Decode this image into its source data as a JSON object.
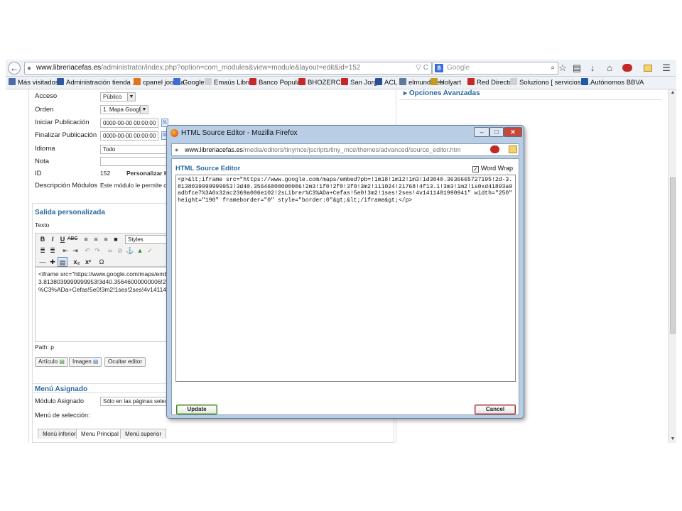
{
  "browser": {
    "url_host": "www.libreriacefas.es",
    "url_path": "/administrator/index.php?option=com_modules&view=module&layout=edit&id=152",
    "search_placeholder": "Google",
    "bookmarks": [
      {
        "label": "Más visitados",
        "color": "#4b6ea8"
      },
      {
        "label": "Administración tienda ...",
        "color": "#2c5aa0"
      },
      {
        "label": "cpanel joomla",
        "color": "#e2731b"
      },
      {
        "label": "Google",
        "color": "#3b6fd8"
      },
      {
        "label": "Emaús Libros",
        "color": "#d0d0d0"
      },
      {
        "label": "Banco Popular",
        "color": "#c62828"
      },
      {
        "label": "BHOZERCK",
        "color": "#c62828"
      },
      {
        "label": "San Jorge",
        "color": "#c62828"
      },
      {
        "label": "ACL",
        "color": "#2b4c9a"
      },
      {
        "label": "elmundo.es",
        "color": "#5f7a98"
      },
      {
        "label": "Holyart",
        "color": "#c59b1b"
      },
      {
        "label": "Red Directo",
        "color": "#c62828"
      },
      {
        "label": "Soluziono [ servicios e...",
        "color": "#d0d0d0"
      },
      {
        "label": "Autónomos BBVA",
        "color": "#1e5aa8"
      }
    ]
  },
  "form": {
    "acceso_label": "Acceso",
    "acceso_value": "Público",
    "orden_label": "Orden",
    "orden_value": "1. Mapa Google",
    "inicio_label": "Iniciar Publicación",
    "inicio_value": "0000-00-00 00:00:00",
    "fin_label": "Finalizar Publicación",
    "fin_value": "0000-00-00 00:00:00",
    "idioma_label": "Idioma",
    "idioma_value": "Todo",
    "nota_label": "Nota",
    "id_label": "ID",
    "id_value": "152",
    "personalizar": "Personalizar H",
    "desc_label": "Descripción Módulos",
    "desc_value": "Este módulo le permite cr",
    "section_salida": "Salida personalizada",
    "texto_label": "Texto",
    "styles_label": "Styles",
    "editor_text": "<iframe src=\"https://www.google.com/maps/emb\n3.8138039999999953!3d40.35646000000006!2\n%C3%ADa+Cefas!5e0!3m2!1ses!2ses!4v14114019",
    "path_label": "Path: p",
    "btn_articulo": "Artículo",
    "btn_imagen": "Imagen",
    "btn_ocultar": "Ocultar editor",
    "section_menu": "Menú Asignado",
    "modulo_asignado_label": "Módulo Asignado",
    "modulo_asignado_value": "Sólo en las páginas seleccion",
    "menu_seleccion_label": "Menú de selección:",
    "tabs": [
      "Menú inferior",
      "Menu Principal",
      "Menú superior"
    ]
  },
  "right": {
    "opciones": "Opciones Avanzadas"
  },
  "popup": {
    "window_title": "HTML Source Editor - Mozilla Firefox",
    "url_host": "www.libreriacefas.es",
    "url_path": "/media/editors/tinymce/jscripts/tiny_mce/themes/advanced/source_editor.htm",
    "heading": "HTML Source Editor",
    "word_wrap_label": "Word Wrap",
    "word_wrap_checked": true,
    "source": "<p>&lt;iframe src=\"https://www.google.com/maps/embed?pb=!1m18!1m12!1m3!1d3040.3636665727195!2d-3.8138039999999953!3d40.35646000000006!2m3!1f0!2f0!3f0!3m2!1i1024!2i768!4f13.1!3m3!1m2!1s0xd41893a9adbfce7%3A0x32ac2369a006e102!2sLibrer%C3%ADa+Cefas!5e0!3m2!1ses!2ses!4v1411401990941\" width=\"250\" height=\"190\" frameborder=\"0\" style=\"border:0\"&gt;&lt;/iframe&gt;</p>",
    "update_label": "Update",
    "cancel_label": "Cancel"
  }
}
